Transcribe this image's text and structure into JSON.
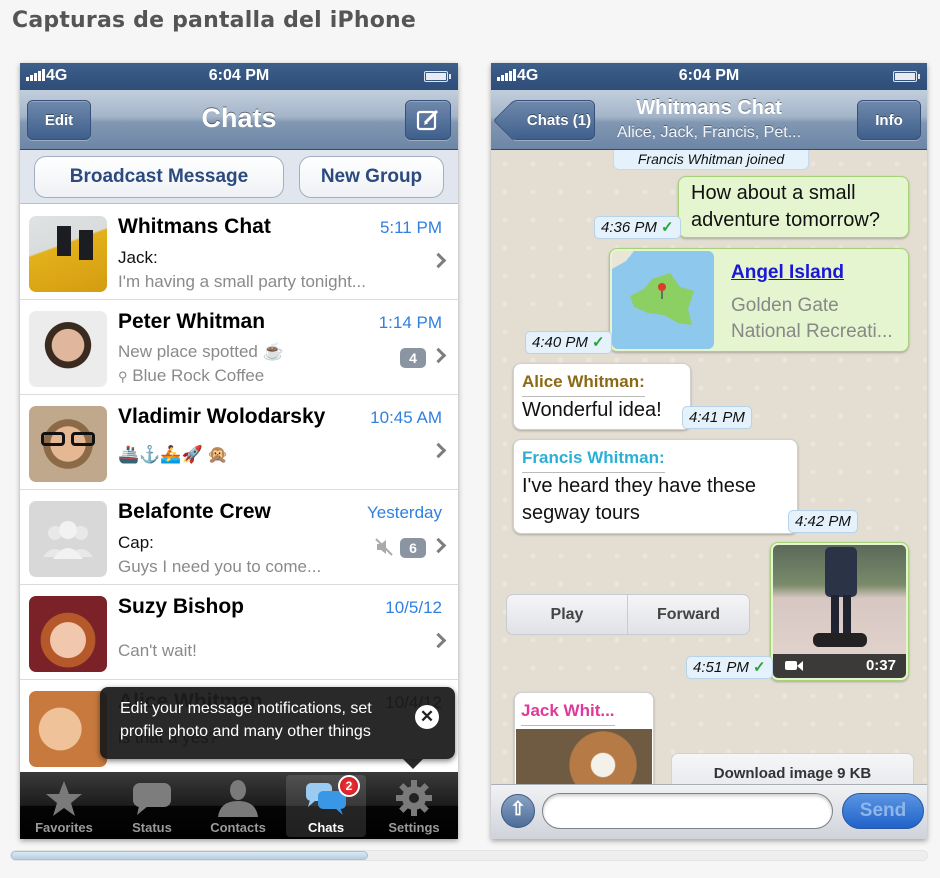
{
  "page": {
    "title": "Capturas de pantalla del iPhone"
  },
  "left": {
    "status": {
      "carrier": "4G",
      "time": "6:04 PM"
    },
    "nav": {
      "edit_label": "Edit",
      "title": "Chats",
      "compose_icon": "compose-icon"
    },
    "actions": {
      "broadcast_label": "Broadcast Message",
      "new_group_label": "New Group"
    },
    "chats": [
      {
        "name": "Whitmans Chat",
        "time": "5:11 PM",
        "sender": "Jack:",
        "preview": "I'm having a small party tonight...",
        "avatar": "group-photo"
      },
      {
        "name": "Peter Whitman",
        "time": "1:14 PM",
        "preview": "New place spotted ☕",
        "location": "Blue Rock Coffee",
        "badge": "4",
        "avatar": "man-mustache-photo"
      },
      {
        "name": "Vladimir Wolodarsky",
        "time": "10:45 AM",
        "preview": "🚢⚓🚣🚀   🙊",
        "avatar": "man-glasses-photo"
      },
      {
        "name": "Belafonte Crew",
        "time": "Yesterday",
        "sender": "Cap:",
        "preview": "Guys I need you to come...",
        "badge": "6",
        "muted": true,
        "avatar": "default-group-avatar"
      },
      {
        "name": "Suzy Bishop",
        "time": "10/5/12",
        "preview": "Can't wait!",
        "avatar": "woman-hat-photo"
      },
      {
        "name": "Alice Whitman",
        "time": "10/4/12",
        "preview": "is that a yes?",
        "avatar": "woman-glasses-photo"
      }
    ],
    "tooltip": {
      "text": "Edit your message notifications, set profile photo and many other things",
      "close_icon": "close-icon"
    },
    "tabs": [
      {
        "label": "Favorites",
        "icon": "star-icon"
      },
      {
        "label": "Status",
        "icon": "speech-bubble-icon"
      },
      {
        "label": "Contacts",
        "icon": "person-icon"
      },
      {
        "label": "Chats",
        "icon": "chats-icon",
        "badge": "2",
        "active": true
      },
      {
        "label": "Settings",
        "icon": "gear-icon"
      }
    ]
  },
  "right": {
    "status": {
      "carrier": "4G",
      "time": "6:04 PM"
    },
    "nav": {
      "back_label": "Chats (1)",
      "title": "Whitmans Chat",
      "subtitle": "Alice, Jack, Francis, Pet...",
      "info_label": "Info"
    },
    "messages": {
      "system": "Francis Whitman joined",
      "m1": {
        "text_line1": "How about a small",
        "text_line2": "adventure tomorrow?",
        "time": "4:36 PM"
      },
      "m2": {
        "title": "Angel Island",
        "line1": "Golden Gate",
        "line2": "National Recreati...",
        "time": "4:40 PM"
      },
      "m3": {
        "sender": "Alice Whitman:",
        "text": "Wonderful idea!",
        "time": "4:41 PM",
        "sender_color": "#8a6a16"
      },
      "m4": {
        "sender": "Francis Whitman:",
        "line1": "I've heard they have these",
        "line2": "segway tours",
        "time": "4:42 PM",
        "sender_color": "#2ab0d6"
      },
      "m5": {
        "duration": "0:37",
        "time": "4:51 PM",
        "play_label": "Play",
        "forward_label": "Forward"
      },
      "m6": {
        "sender": "Jack Whit...",
        "sender_color": "#e0399a",
        "download_label": "Download image 9 KB"
      }
    },
    "input": {
      "value": "",
      "send_label": "Send"
    }
  },
  "scrollbar": {
    "position_fraction": 0.39
  }
}
